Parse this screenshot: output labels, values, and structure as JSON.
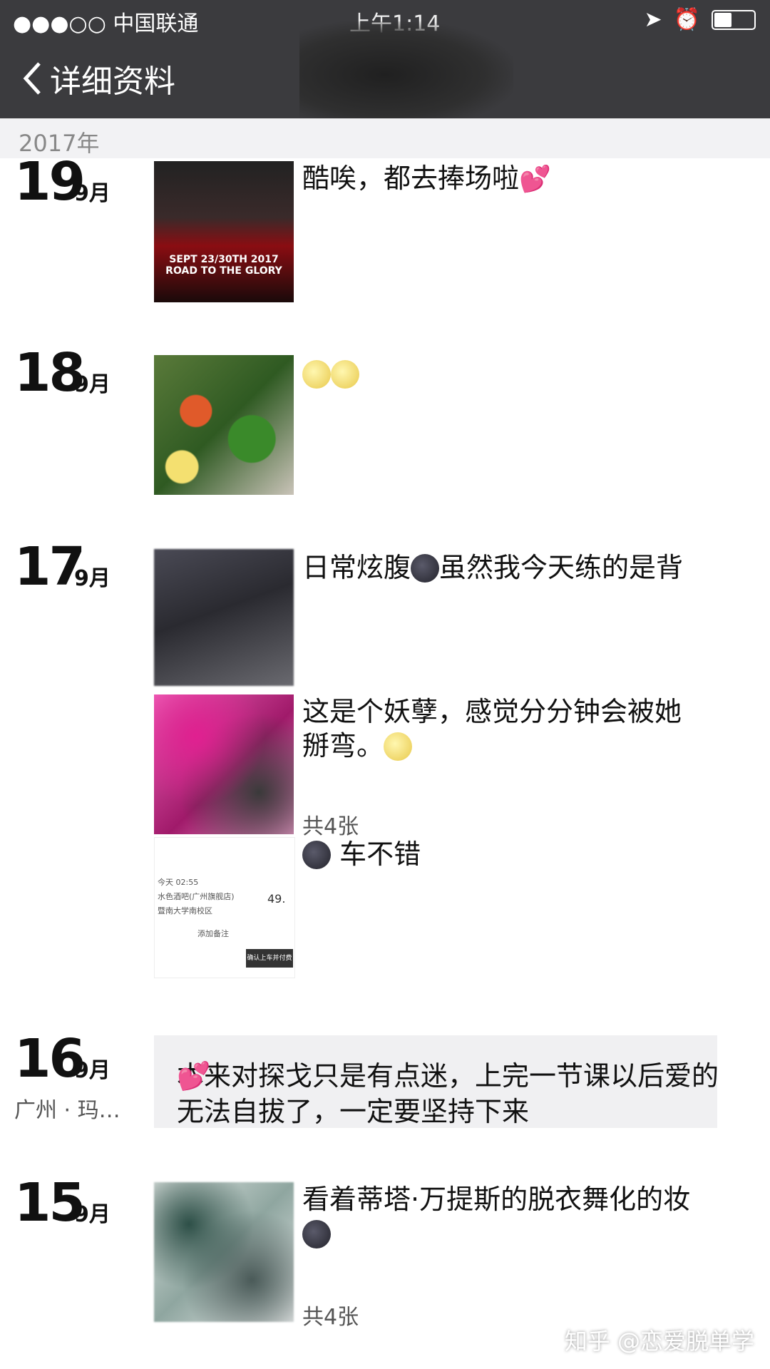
{
  "status_bar": {
    "carrier": "●●●○○ 中国联通",
    "time": "上午1:14"
  },
  "nav": {
    "back_label": "详细资料"
  },
  "year": "2017年",
  "posts": [
    {
      "day": "19",
      "month": "9月",
      "text": "酷唉，都去捧场啦",
      "poster_text": "SEPT 23/30TH 2017 ROAD TO THE GLORY"
    },
    {
      "day": "18",
      "month": "9月",
      "text": ""
    },
    {
      "day": "17",
      "month": "9月",
      "entries": [
        {
          "text_before": "日常炫腹",
          "text_after": "虽然我今天练的是背"
        },
        {
          "text": "这是个妖孽，感觉分分钟会被她掰弯。",
          "count": "共4张"
        },
        {
          "text": "车不错",
          "ride_lines": [
            "今天 02:55",
            "水色酒吧(广州旗舰店)",
            "暨南大学南校区",
            "添加备注",
            "确认上车并付费"
          ],
          "price": "49."
        }
      ]
    },
    {
      "day": "16",
      "month": "9月",
      "location": "广州 · 玛…",
      "text": "本来对探戈只是有点迷，上完一节课以后爱的无法自拔了，一定要坚持下来"
    },
    {
      "day": "15",
      "month": "9月",
      "text": "看着蒂塔·万提斯的脱衣舞化的妆",
      "count": "共4张"
    }
  ],
  "watermark": "知乎 @恋爱脱单学"
}
